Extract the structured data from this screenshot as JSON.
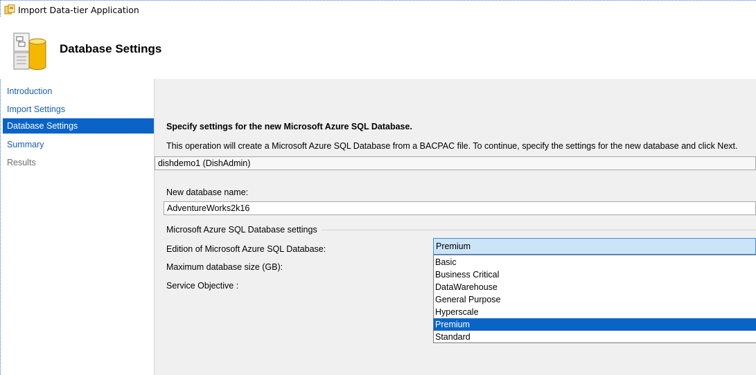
{
  "window": {
    "title": "Import Data-tier Application"
  },
  "header": {
    "title": "Database Settings",
    "icon": "database-settings-icon"
  },
  "nav": {
    "items": [
      {
        "label": "Introduction",
        "state": "link"
      },
      {
        "label": "Import Settings",
        "state": "link"
      },
      {
        "label": "Database Settings",
        "state": "active"
      },
      {
        "label": "Summary",
        "state": "link"
      },
      {
        "label": "Results",
        "state": "disabled"
      }
    ]
  },
  "main": {
    "heading": "Specify settings for the new Microsoft Azure SQL Database.",
    "description": "This operation will create a Microsoft Azure SQL Database from a BACPAC file. To continue, specify the settings for the new database and click Next.",
    "server": "dishdemo1 (DishAdmin)",
    "db_name_label": "New database name:",
    "db_name_value": "AdventureWorks2k16",
    "group_label": "Microsoft Azure SQL Database settings",
    "edition_label": "Edition of Microsoft Azure SQL Database:",
    "max_size_label": "Maximum database size (GB):",
    "service_objective_label": "Service Objective :",
    "edition_selected": "Premium",
    "edition_options": [
      "Basic",
      "Business Critical",
      "DataWarehouse",
      "General Purpose",
      "Hyperscale",
      "Premium",
      "Standard"
    ]
  },
  "colors": {
    "accent": "#0a64c8",
    "link": "#1a5fb4",
    "combo_bg": "#cce4f7",
    "content_bg": "#f0f0f0"
  }
}
